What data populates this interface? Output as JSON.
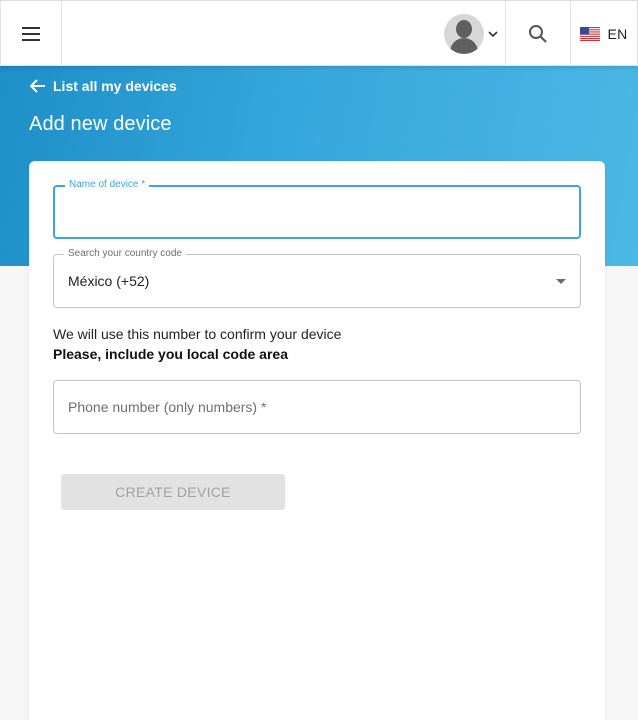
{
  "header": {
    "language": "EN",
    "icons": {
      "menu": "hamburger-menu-icon",
      "avatar": "user-avatar",
      "dropdown": "chevron-down-icon",
      "search": "search-icon",
      "flag": "us-flag-icon"
    }
  },
  "hero": {
    "back_link": "List all my devices",
    "title": "Add new device",
    "gradient_start": "#1e8fc7",
    "gradient_end": "#4bb8e6"
  },
  "form": {
    "device_name": {
      "label": "Name of device *",
      "value": ""
    },
    "country_code": {
      "label": "Search your country code",
      "selected": "México (+52)"
    },
    "info_text": "We will use this number to confirm your device",
    "info_bold": "Please, include you local code area",
    "phone": {
      "placeholder": "Phone number (only numbers) *",
      "value": ""
    },
    "submit_label": "CREATE DEVICE"
  },
  "colors": {
    "accent": "#39a5d8",
    "disabled_button": "#e2e2e2",
    "disabled_text": "#a2a2a2"
  }
}
